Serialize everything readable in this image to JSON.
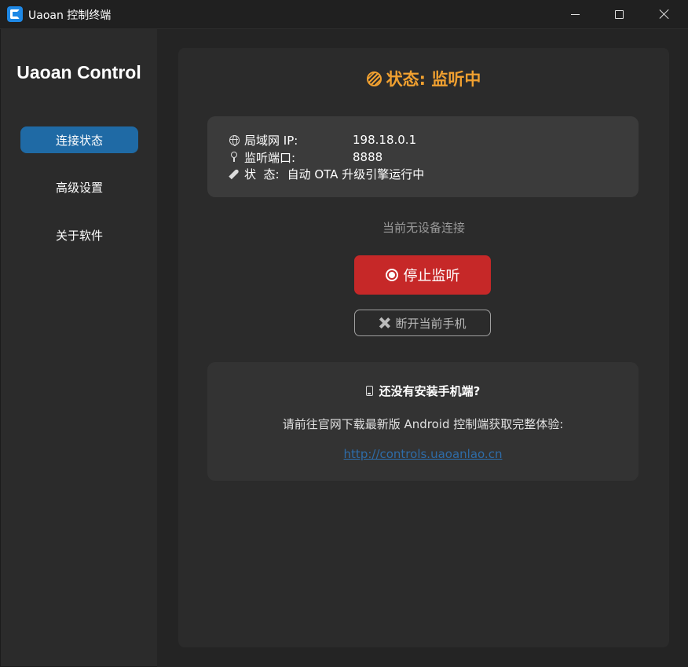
{
  "window": {
    "title": "Uaoan 控制终端"
  },
  "sidebar": {
    "brand": "Uaoan Control",
    "items": [
      {
        "label": "连接状态",
        "active": true
      },
      {
        "label": "高级设置",
        "active": false
      },
      {
        "label": "关于软件",
        "active": false
      }
    ]
  },
  "main": {
    "status_title": "状态: 监听中",
    "status_color": "#f0a030",
    "info": {
      "ip_label": "局域网 IP:",
      "ip_value": "198.18.0.1",
      "port_label": "监听端口:",
      "port_value": "8888",
      "state_label": "状  态:",
      "state_value": "自动 OTA 升级引擎运行中"
    },
    "no_device_text": "当前无设备连接",
    "stop_button": "停止监听",
    "stop_button_color": "#c62828",
    "disconnect_button": "断开当前手机",
    "promo": {
      "title": "还没有安装手机端?",
      "description": "请前往官网下载最新版 Android 控制端获取完整体验:",
      "link": "http://controls.uaoanlao.cn"
    }
  },
  "colors": {
    "accent": "#1f6aa5",
    "link": "#2e6ca8"
  }
}
